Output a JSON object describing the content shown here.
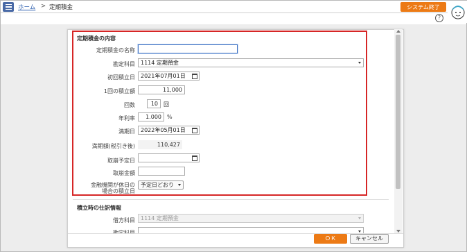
{
  "header": {
    "home_link": "ホーム",
    "separator": ">",
    "current_page": "定期積金",
    "exit_button": "システム終了"
  },
  "help_label": "?",
  "form": {
    "section_title": "定期積金の内容",
    "fields": {
      "name": {
        "label": "定期積金の名称",
        "value": ""
      },
      "account": {
        "label": "勘定科目",
        "value": "1114 定期預金"
      },
      "first_date": {
        "label": "初回積立日",
        "value": "2021年07月01日"
      },
      "amount": {
        "label": "1回の積立額",
        "value": "11,000"
      },
      "count": {
        "label": "回数",
        "value": "10",
        "unit": "回"
      },
      "rate": {
        "label": "年利率",
        "value": "1.000",
        "unit": "%"
      },
      "maturity_date": {
        "label": "満期日",
        "value": "2022年05月01日"
      },
      "maturity_amount": {
        "label": "満期額(税引き後)",
        "value": "110,427"
      },
      "cancel_date": {
        "label": "取崩予定日",
        "value": ""
      },
      "cancel_amount": {
        "label": "取崩金額",
        "value": ""
      },
      "holiday": {
        "label_line1": "金融機関が休日の",
        "label_line2": "場合の積立日",
        "value": "予定日どおり"
      }
    }
  },
  "journal": {
    "section_title": "積立時の仕訳情報",
    "debit": {
      "label": "借方科目",
      "value": "1114 定期預金"
    },
    "account": {
      "label": "勘定科目",
      "value": ""
    }
  },
  "footer": {
    "ok": "ＯＫ",
    "cancel": "キャンセル"
  },
  "colors": {
    "accent": "#ec7a15",
    "highlight_border": "#d62626",
    "menu": "#4a6aa6"
  }
}
